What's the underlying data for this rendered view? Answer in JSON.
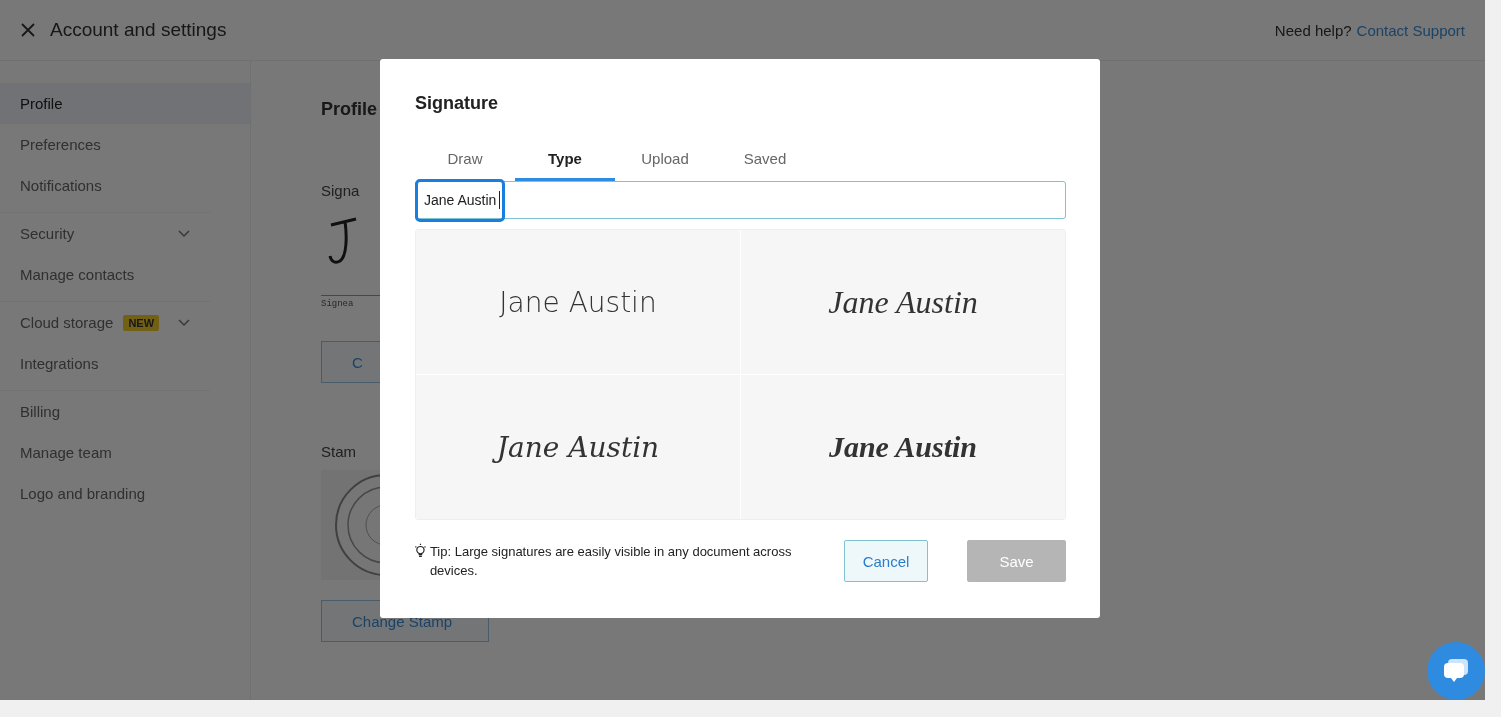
{
  "header": {
    "title": "Account and settings",
    "help_text": "Need help?",
    "help_link": "Contact Support"
  },
  "sidebar": {
    "groups": [
      {
        "items": [
          {
            "label": "Profile",
            "selected": true
          },
          {
            "label": "Preferences",
            "selected": false
          },
          {
            "label": "Notifications",
            "selected": false
          }
        ]
      },
      {
        "items": [
          {
            "label": "Security",
            "selected": false,
            "expandable": true
          },
          {
            "label": "Manage contacts",
            "selected": false
          }
        ]
      },
      {
        "items": [
          {
            "label": "Cloud storage",
            "selected": false,
            "expandable": true,
            "badge": "NEW"
          },
          {
            "label": "Integrations",
            "selected": false
          }
        ]
      },
      {
        "items": [
          {
            "label": "Billing",
            "selected": false
          },
          {
            "label": "Manage team",
            "selected": false
          },
          {
            "label": "Logo and branding",
            "selected": false
          }
        ]
      }
    ]
  },
  "content": {
    "heading": "Profile",
    "signature_label": "Signa",
    "signature_caption": "Signea",
    "signature_button": "C",
    "stamp_label": "Stam",
    "stamp_button": "Change Stamp"
  },
  "dialog": {
    "title": "Signature",
    "tabs": [
      {
        "label": "Draw",
        "selected": false
      },
      {
        "label": "Type",
        "selected": true
      },
      {
        "label": "Upload",
        "selected": false
      },
      {
        "label": "Saved",
        "selected": false
      }
    ],
    "name_input": {
      "value": "Jane Austin"
    },
    "styles": [
      {
        "text": "Jane Austin"
      },
      {
        "text": "Jane Austin"
      },
      {
        "text": "Jane Austin"
      },
      {
        "text": "Jane Austin"
      }
    ],
    "tip": "Tip: Large signatures are easily visible in any document across devices.",
    "buttons": [
      {
        "label": "Cancel",
        "kind": "secondary",
        "disabled": false
      },
      {
        "label": "Save",
        "kind": "primary",
        "disabled": true
      }
    ]
  }
}
